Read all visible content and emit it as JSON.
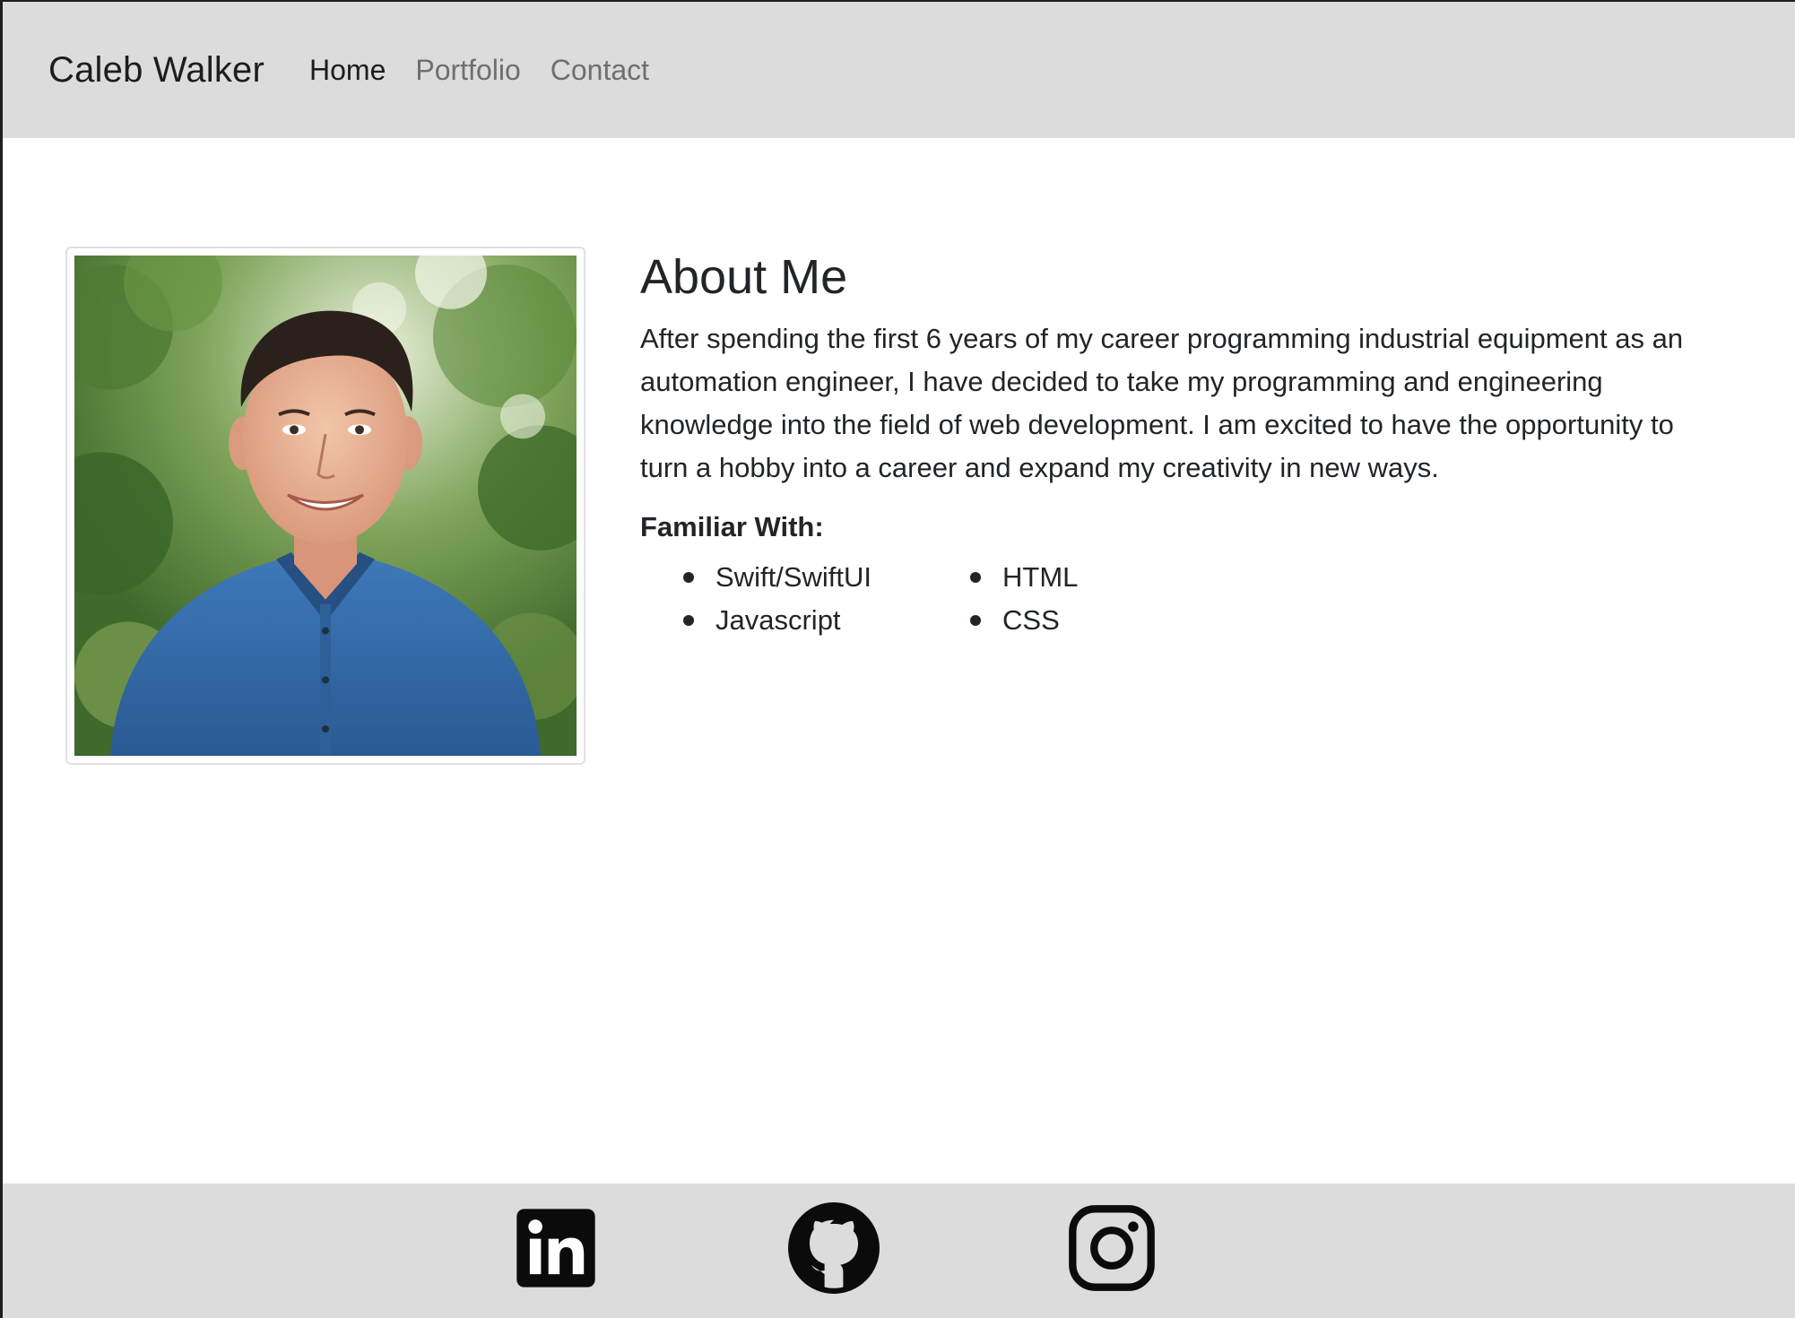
{
  "navbar": {
    "brand": "Caleb Walker",
    "links": [
      {
        "label": "Home",
        "active": true
      },
      {
        "label": "Portfolio",
        "active": false
      },
      {
        "label": "Contact",
        "active": false
      }
    ]
  },
  "about": {
    "title": "About Me",
    "body": "After spending the first 6 years of my career programming industrial equipment as an automation engineer, I have decided to take my programming and engineering knowledge into the field of web development. I am excited to have the opportunity to turn a hobby into a career and expand my creativity in new ways.",
    "familiar_heading": "Familiar With:",
    "skills": [
      "Swift/SwiftUI",
      "HTML",
      "Javascript",
      "CSS"
    ]
  },
  "footer": {
    "icons": [
      "linkedin-icon",
      "github-icon",
      "instagram-icon"
    ]
  },
  "colors": {
    "bar_background": "#dcdcdc",
    "text": "#212529",
    "inactive_link": "#6f6f6f"
  }
}
